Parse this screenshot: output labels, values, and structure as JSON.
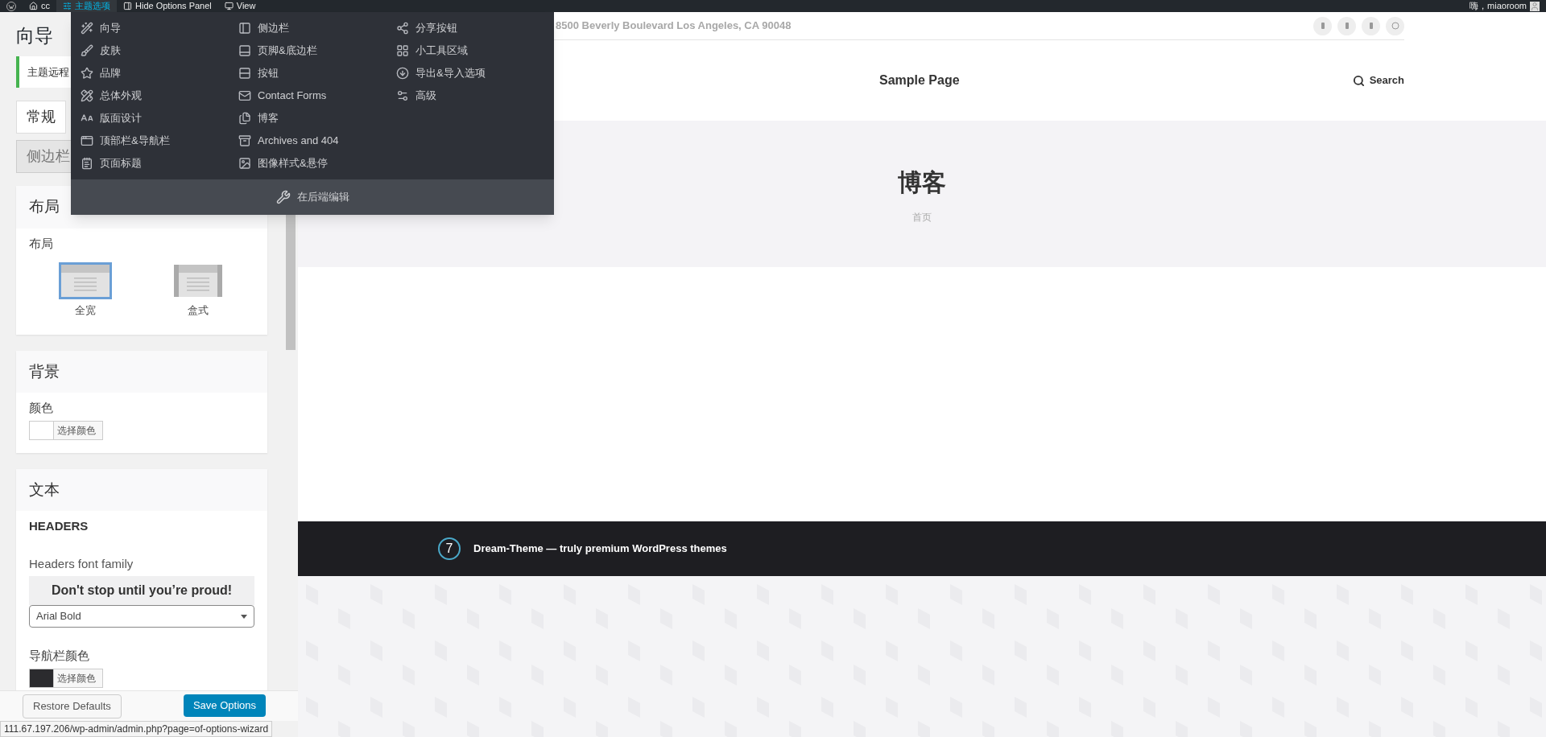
{
  "admin_bar": {
    "items": [
      {
        "label": "cc",
        "selected": false
      },
      {
        "label": "主题选项",
        "selected": true
      },
      {
        "label": "Hide Options Panel",
        "selected": false
      },
      {
        "label": "View",
        "selected": false
      }
    ],
    "greeting": "嗨，miaoroom"
  },
  "options_menu": {
    "columns": [
      [
        "向导",
        "皮肤",
        "品牌",
        "总体外观",
        "版面设计",
        "顶部栏&导航栏",
        "页面标题"
      ],
      [
        "侧边栏",
        "页脚&底边栏",
        "按钮",
        "Contact Forms",
        "博客",
        "Archives and 404",
        "图像样式&悬停"
      ],
      [
        "分享按钮",
        "小工具区域",
        "导出&导入选项",
        "高级"
      ]
    ],
    "footer_link": "在后端编辑"
  },
  "panel": {
    "title": "向导",
    "notice": "主题远程",
    "tabs": [
      {
        "label": "常规",
        "selected": true
      },
      {
        "label": "侧边栏",
        "selected": false
      }
    ],
    "cards": [
      {
        "kind": "layout",
        "title": "布局",
        "label": "布局",
        "options": [
          {
            "label": "全宽",
            "selected": true
          },
          {
            "label": "盒式",
            "selected": false
          }
        ]
      },
      {
        "kind": "color",
        "title": "背景",
        "fields": [
          {
            "label": "颜色",
            "button": "选择颜色",
            "color": "#ffffff"
          }
        ]
      },
      {
        "kind": "text",
        "title": "文本",
        "heading": "HEADERS",
        "font_label": "Headers font family",
        "preview": "Don't stop until you’re proud!",
        "font_value": "Arial Bold",
        "fields": [
          {
            "label": "导航栏颜色",
            "button": "选择颜色",
            "color": "#2b2b2e"
          }
        ]
      }
    ],
    "buttons": [
      {
        "label": "Restore Defaults",
        "kind": "secondary"
      },
      {
        "label": "Save Options",
        "kind": "primary"
      }
    ]
  },
  "preview": {
    "address": "8500 Beverly Boulevard Los Angeles, CA 90048",
    "menu_item": "Sample Page",
    "search": "Search",
    "page_title": "博客",
    "breadcrumb": "首页",
    "footer_text": "Dream-Theme — truly premium WordPress themes",
    "logo": "7"
  },
  "status_url": "111.67.197.206/wp-admin/admin.php?page=of-options-wizard"
}
